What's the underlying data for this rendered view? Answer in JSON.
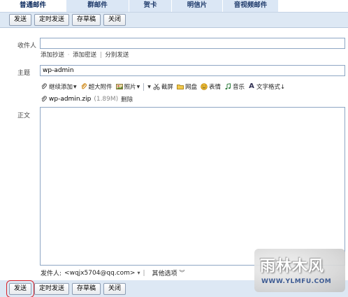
{
  "tabs": [
    {
      "label": "普通邮件"
    },
    {
      "label": "群邮件"
    },
    {
      "label": "贺卡"
    },
    {
      "label": "明信片"
    },
    {
      "label": "音视频邮件"
    }
  ],
  "toolbar": {
    "send": "发送",
    "scheduled_send": "定时发送",
    "save_draft": "存草稿",
    "close": "关闭"
  },
  "compose": {
    "recipient_label": "收件人",
    "recipient_value": "",
    "cc_link": "添加抄送",
    "bcc_link": "添加密送",
    "separate_send_link": "分别发送",
    "dot_sep": "·",
    "bar_sep": "|",
    "subject_label": "主题",
    "subject_value": "wp-admin",
    "body_label": "正文"
  },
  "format_bar": {
    "continue_add": "继续添加",
    "super_attachment": "超大附件",
    "photo": "照片",
    "screenshot": "截屏",
    "netdisk": "网盘",
    "emoji": "表情",
    "music": "音乐",
    "text_format": "文字格式↓"
  },
  "attachment": {
    "filename": "wp-admin.zip",
    "size": "(1.89M)",
    "delete": "删除"
  },
  "sender": {
    "label": "发件人:",
    "address": "<wqjx5704@qq.com>",
    "dropdown_glyph": "▾",
    "sep": "|",
    "other_options": "其他选项",
    "options_glyph": "︾"
  },
  "watermark": {
    "title": "雨林木风",
    "url": "WWW.YLMFU.COM"
  },
  "colors": {
    "tab_text": "#1f3b6b",
    "toolbar_bg": "#dde8f4",
    "input_border": "#8ea6c4",
    "highlight_box": "#d8222a"
  }
}
